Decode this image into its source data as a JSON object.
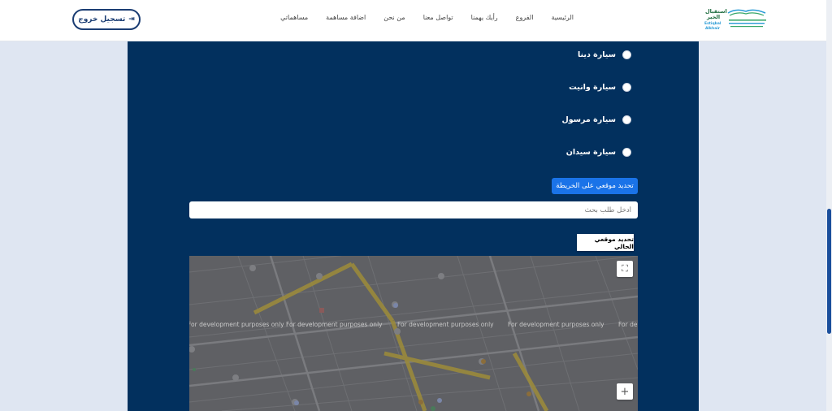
{
  "header": {
    "logout_label": "تسجيل خروج",
    "logout_icon": "sign-out-icon",
    "nav": [
      "الرئيسية",
      "الفروع",
      "رأيك يهمنا",
      "تواصل معنا",
      "من نحن",
      "اضافة مساهمة",
      "مساهماتي"
    ],
    "logo_text_line1": "استقبال",
    "logo_text_line2": "الخير",
    "logo_text_line3": "Estiqbal",
    "logo_text_line4": "Alkhair"
  },
  "vehicles": {
    "options": [
      "سيارة دينا",
      "سيارة وانيت",
      "سيارة مرسول",
      "سيارة سيدان"
    ]
  },
  "location": {
    "map_button_label": "تحديد موقعي على الخريطة",
    "search_placeholder": "أدخل طلب بحث",
    "current_location_label": "تحديد موقعي الحالي",
    "watermark": "For development purposes only",
    "zoom_in": "+"
  },
  "colors": {
    "panel": "#02305e",
    "accent": "#1a73e8",
    "brand": "#1b3d73"
  }
}
